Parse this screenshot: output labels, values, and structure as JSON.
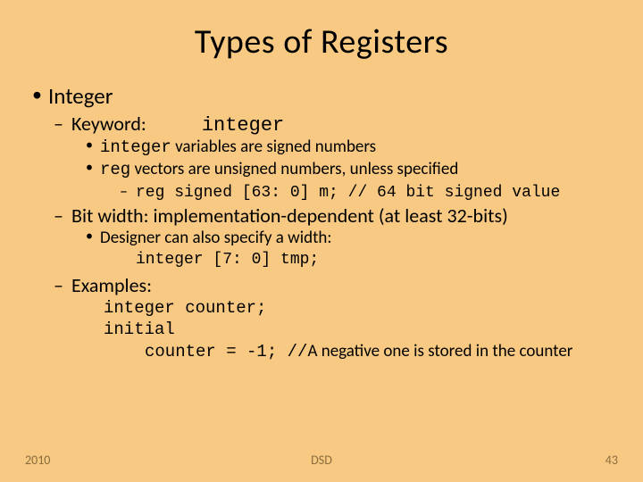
{
  "title": "Types of Registers",
  "l1a": "Integer",
  "kw_label": "Keyword:",
  "kw_code": "integer",
  "int_code1": "integer",
  "int_rest1": " variables are signed numbers",
  "reg_code2": "reg",
  "reg_rest2": " vectors are unsigned numbers, unless specified",
  "signed_code": "reg signed [63: 0] m; // 64 bit signed value",
  "bitwidth": "Bit width: implementation-dependent (at least 32-bits)",
  "designer": "Designer can also specify a width:",
  "tmp_code": "integer [7: 0] tmp;",
  "examples": "Examples:",
  "ex_line1": "integer counter;",
  "ex_line2": "initial",
  "ex_line3a": "counter = -1; //",
  "ex_line3b": "A negative one is stored in the counter",
  "footer_left": "2010",
  "footer_center": "DSD",
  "footer_right": "43"
}
